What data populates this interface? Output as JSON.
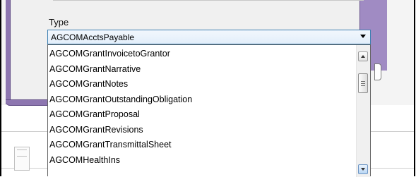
{
  "type_field": {
    "label": "Type",
    "selected_value": "AGCOMAcctsPayable"
  },
  "dropdown": {
    "items": [
      "AGCOMGrantInvoicetoGrantor",
      "AGCOMGrantNarrative",
      "AGCOMGrantNotes",
      "AGCOMGrantOutstandingObligation",
      "AGCOMGrantProposal",
      "AGCOMGrantRevisions",
      "AGCOMGrantTransmittalSheet",
      "AGCOMHealthIns"
    ],
    "scroll_position": 0.15
  },
  "icons": {
    "combo_arrow": "chevron-down-icon",
    "scroll_up": "arrow-up-icon",
    "scroll_down": "arrow-down-icon",
    "thumb_grip": "grip-icon"
  },
  "colors": {
    "window_chrome": "#8d76b0",
    "combo_border": "#3c7fb1",
    "combo_fill": "#e2eefa"
  }
}
